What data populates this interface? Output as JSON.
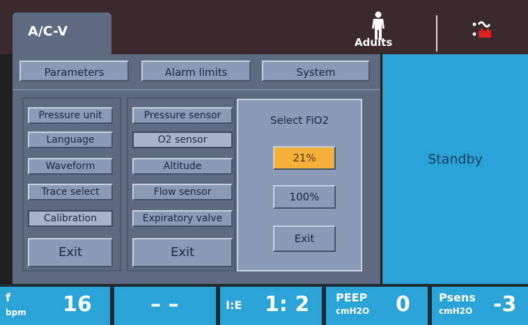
{
  "header": {
    "mode": "A/C-V",
    "patient_type": "Adults",
    "patient_icon": "adult-person-icon",
    "power_icon": "ac-battery-icon"
  },
  "tabs": [
    {
      "label": "Parameters"
    },
    {
      "label": "Alarm limits"
    },
    {
      "label": "System"
    }
  ],
  "column1": {
    "items": [
      "Pressure unit",
      "Language",
      "Waveform",
      "Trace select",
      "Calibration"
    ],
    "exit": "Exit"
  },
  "column2": {
    "items": [
      "Pressure sensor",
      "O2 sensor",
      "Altitude",
      "Flow sensor",
      "Expiratory valve"
    ],
    "exit": "Exit"
  },
  "fio2": {
    "title": "Select FiO2",
    "options": [
      "21%",
      "100%"
    ],
    "selected": "21%",
    "exit": "Exit"
  },
  "status": {
    "text": "Standby"
  },
  "bottom": {
    "f": {
      "label": "f",
      "unit": "bpm",
      "value": "16"
    },
    "blank": {
      "value": "– –"
    },
    "ie": {
      "label": "I:E",
      "value": "1: 2"
    },
    "peep": {
      "label": "PEEP",
      "unit": "cmH2O",
      "value": "0"
    },
    "psens": {
      "label": "Psens",
      "unit": "cmH2O",
      "value": "-3"
    }
  },
  "colors": {
    "accent": "#2aa3d6",
    "selected": "#f3b13a",
    "panel": "#5d6a80",
    "button": "#8b9ab5"
  }
}
